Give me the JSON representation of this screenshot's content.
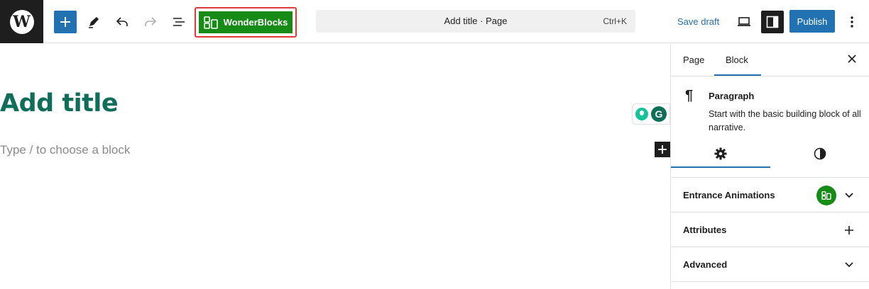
{
  "topbar": {
    "logo_icon": "wordpress-logo-icon",
    "logo_text": "W",
    "add_block_icon": "plus-icon",
    "tools_icon": "pencil-icon",
    "undo_icon": "undo-icon",
    "redo_icon": "redo-icon",
    "outline_icon": "list-view-icon",
    "wonderblocks_label": "WonderBlocks",
    "wonderblocks_color": "#168b16",
    "highlight_color": "#e23a3a",
    "command_title": "Add title · Page",
    "command_shortcut": "Ctrl+K",
    "save_draft_label": "Save draft",
    "preview_icon": "laptop-icon",
    "settings_icon": "sidebar-toggle-icon",
    "publish_label": "Publish",
    "options_icon": "more-vertical-icon",
    "accent_color": "#2271b1"
  },
  "editor": {
    "title_placeholder": "Add title",
    "title_color": "#0f6e5a",
    "block_placeholder": "Type / to choose a block",
    "grammarly_icon": "grammarly-icon",
    "grammarly_letter": "G",
    "inserter_icon": "plus-icon"
  },
  "sidebar": {
    "tab_page": "Page",
    "tab_block": "Block",
    "close_icon": "close-icon",
    "block": {
      "icon": "pilcrow-icon",
      "icon_glyph": "¶",
      "name": "Paragraph",
      "description": "Start with the basic building block of all narrative."
    },
    "subtabs": {
      "settings_icon": "gear-icon",
      "styles_icon": "contrast-icon"
    },
    "panels": [
      {
        "label": "Entrance Animations",
        "control_icon": "chevron-down-icon"
      },
      {
        "label": "Attributes",
        "control_icon": "plus-icon"
      },
      {
        "label": "Advanced",
        "control_icon": "chevron-down-icon"
      }
    ]
  }
}
